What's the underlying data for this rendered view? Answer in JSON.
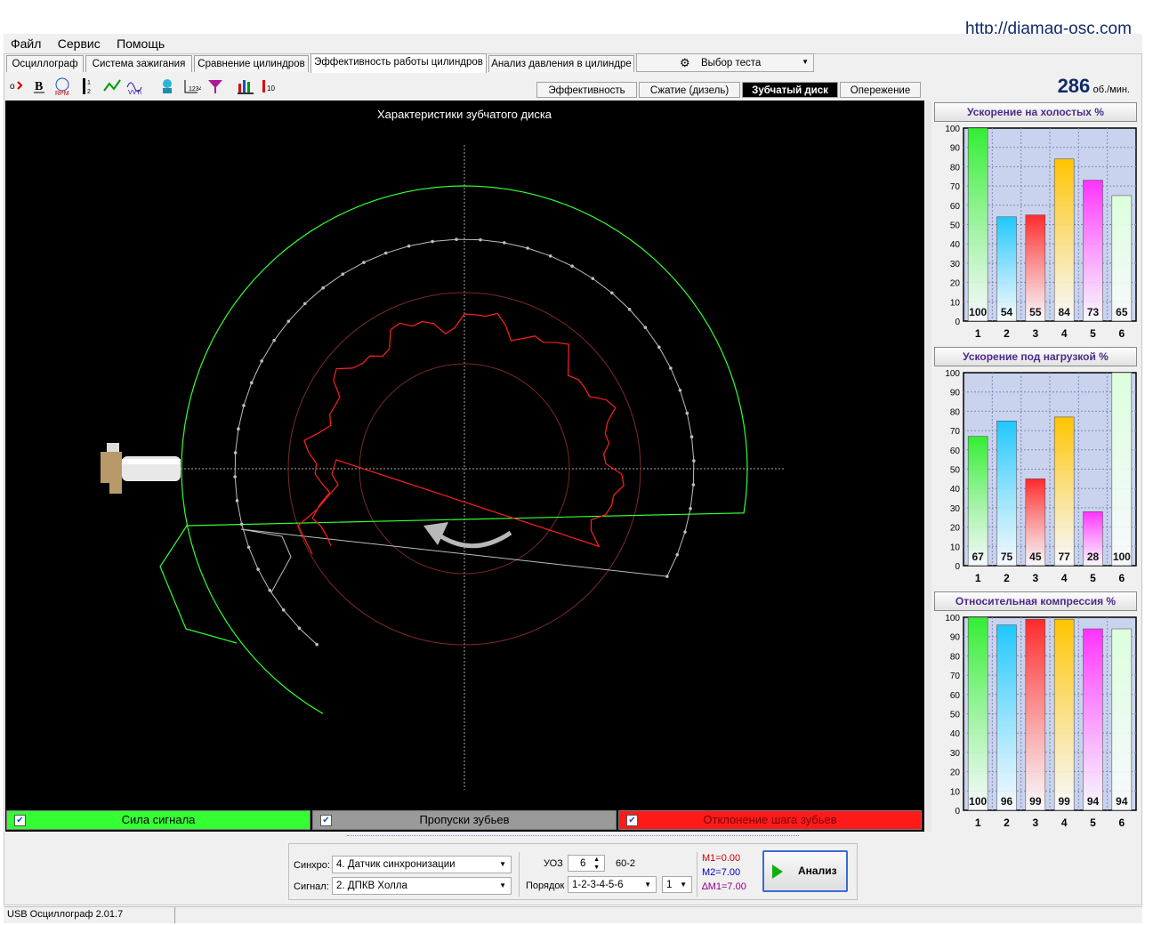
{
  "header": {
    "url": "http://diamag-osc.com"
  },
  "menu": {
    "items": [
      "Файл",
      "Сервис",
      "Помощь"
    ]
  },
  "tabs": {
    "items": [
      "Осциллограф",
      "Система зажигания",
      "Сравнение цилиндров",
      "Эффективность работы цилиндров",
      "Анализ давления в цилиндре"
    ],
    "active_index": 3,
    "test_select": "Выбор теста"
  },
  "subtabs": {
    "items": [
      "Эффективность",
      "Сжатие (дизель)",
      "Зубчатый диск",
      "Опережение"
    ],
    "active_index": 2
  },
  "rpm": {
    "value": "286",
    "unit": "об./мин."
  },
  "plot": {
    "title": "Характеристики зубчатого диска"
  },
  "legend": {
    "items": [
      {
        "label": "Сила сигнала",
        "color": "#33ff33",
        "checked": true
      },
      {
        "label": "Пропуски зубьев",
        "color": "#9a9a9a",
        "checked": true
      },
      {
        "label": "Отклонение шага зубьев",
        "color": "#ff1a1a",
        "checked": true
      }
    ]
  },
  "colors": {
    "canvas_bg": "#000000",
    "signal_strength": "#33ff33",
    "tooth_gaps": "#bdbdbd",
    "pitch_deviation": "#ff2020",
    "reference_rings": "#7a2a2a",
    "chart_bg": "#c9d3ee",
    "bar_colors": [
      "#33ee33",
      "#1ec8ff",
      "#ff2a2a",
      "#ffc400",
      "#ff33ff",
      "#dcffdc"
    ]
  },
  "chart_data": [
    {
      "type": "bar",
      "title": "Ускорение на холостых %",
      "categories": [
        "1",
        "2",
        "3",
        "4",
        "5",
        "6"
      ],
      "values": [
        100,
        54,
        55,
        84,
        73,
        65
      ],
      "labels": [
        "100",
        "54",
        "55",
        "84",
        "73",
        "65"
      ],
      "ylim": [
        0,
        100
      ],
      "yticks": [
        "0",
        "10",
        "20",
        "30",
        "40",
        "50",
        "60",
        "70",
        "80",
        "90",
        "100"
      ],
      "grid": true
    },
    {
      "type": "bar",
      "title": "Ускорение под нагрузкой %",
      "categories": [
        "1",
        "2",
        "3",
        "4",
        "5",
        "6"
      ],
      "values": [
        67,
        75,
        45,
        77,
        28,
        100
      ],
      "labels": [
        "67",
        "75",
        "45",
        "77",
        "28",
        "100"
      ],
      "ylim": [
        0,
        100
      ],
      "yticks": [
        "0",
        "10",
        "20",
        "30",
        "40",
        "50",
        "60",
        "70",
        "80",
        "90",
        "100"
      ],
      "grid": true
    },
    {
      "type": "bar",
      "title": "Относительная компрессия %",
      "categories": [
        "1",
        "2",
        "3",
        "4",
        "5",
        "6"
      ],
      "values": [
        100,
        96,
        99,
        99,
        94,
        94
      ],
      "labels": [
        "100",
        "96",
        "99",
        "99",
        "94",
        "94"
      ],
      "ylim": [
        0,
        100
      ],
      "yticks": [
        "0",
        "10",
        "20",
        "30",
        "40",
        "50",
        "60",
        "70",
        "80",
        "90",
        "100"
      ],
      "grid": true
    }
  ],
  "controls": {
    "sync_label": "Синхро:",
    "sync_value": "4.  Датчик синхронизации",
    "signal_label": "Сигнал:",
    "signal_value": "2.  ДПКВ Холла",
    "uoz_label": "УОЗ",
    "uoz_value": "6",
    "teeth": "60-2",
    "order_label": "Порядок",
    "order_value": "1-2-3-4-5-6",
    "order_cyl": "1",
    "m1": "M1=0.00",
    "m2": "M2=7.00",
    "dm1": "∆M1=7.00",
    "analyze_label": "Анализ"
  },
  "status": {
    "version": "USB Осциллограф  2.01.7"
  }
}
